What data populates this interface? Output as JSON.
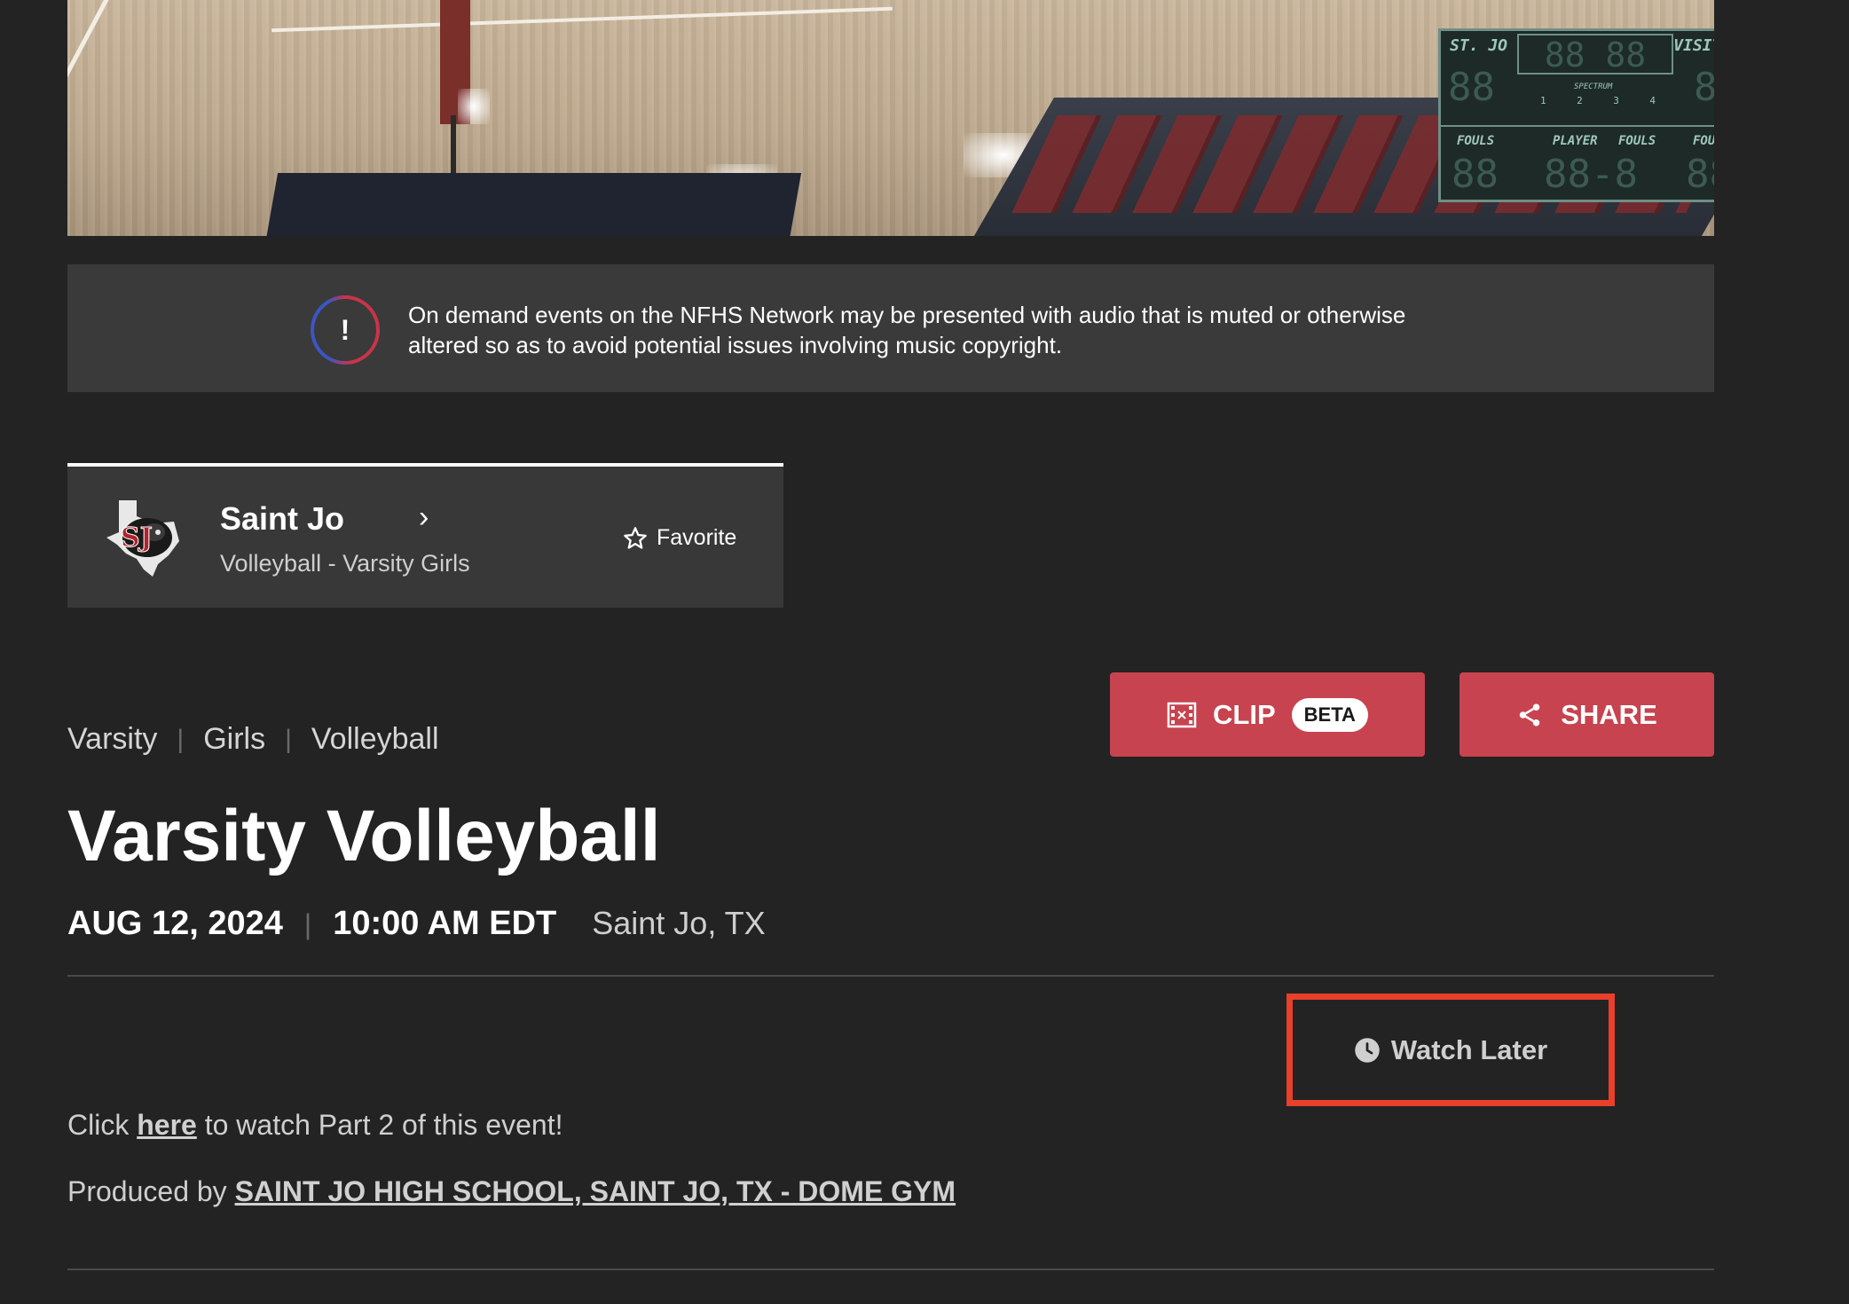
{
  "video": {
    "scoreboard": {
      "home_label": "ST. JO",
      "visitor_label": "VISITOR",
      "brand": "SPECTRUM",
      "periods": [
        "1",
        "2",
        "3",
        "4"
      ],
      "fouls_left": "FOULS",
      "player_label": "PLAYER",
      "fouls_mid": "FOULS",
      "fouls_right": "FOULS"
    }
  },
  "notice": {
    "icon": "exclamation-icon",
    "text": "On demand events on the NFHS Network may be presented with audio that is muted or otherwise altered so as to avoid potential issues involving music copyright."
  },
  "team": {
    "name": "Saint Jo",
    "subtitle": "Volleyball - Varsity Girls",
    "favorite_label": "Favorite"
  },
  "actions": {
    "clip_label": "CLIP",
    "beta_label": "BETA",
    "share_label": "SHARE",
    "accent_color": "#c7434f"
  },
  "event": {
    "tags": [
      "Varsity",
      "Girls",
      "Volleyball"
    ],
    "title": "Varsity Volleyball",
    "date": "AUG 12, 2024",
    "time": "10:00 AM EDT",
    "location": "Saint Jo, TX"
  },
  "watch_later": {
    "label": "Watch Later",
    "highlight_color": "#e8402a"
  },
  "description": {
    "part2_prefix": "Click ",
    "part2_link": "here",
    "part2_suffix": " to watch Part 2 of this event!",
    "produced_prefix": "Produced by ",
    "produced_link": "SAINT JO HIGH SCHOOL, SAINT JO, TX - DOME GYM"
  }
}
